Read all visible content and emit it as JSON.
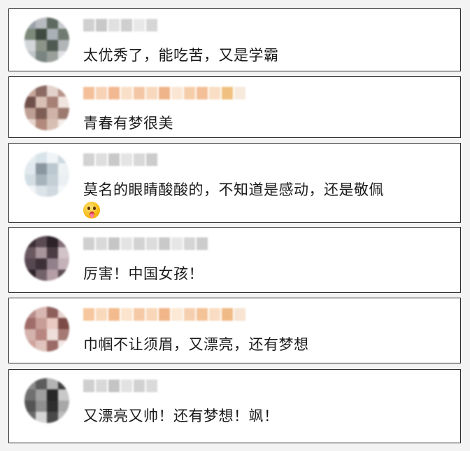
{
  "comments": [
    {
      "text": "太优秀了，能吃苦，又是学霸",
      "avatar_colors": [
        "#9aa0a8",
        "#b8bcc0",
        "#5e6a60",
        "#c6c9cd",
        "#7d8a7a",
        "#3f4a40",
        "#a9b0b6",
        "#6f7a70",
        "#d3d6d9",
        "#8c948a",
        "#4e5a52",
        "#b1b5b8",
        "#c0c4c8",
        "#7a8480",
        "#99a09c",
        "#e0e2e4"
      ],
      "name_colors": [
        "#d0d0d0",
        "#c8c8c8",
        "#e0e0e0",
        "#cfcfcf",
        "#e8e8e8",
        "#d6d6d6"
      ]
    },
    {
      "text": "青春有梦很美",
      "avatar_colors": [
        "#c7a79b",
        "#8a6a62",
        "#e3d2cb",
        "#b69387",
        "#6f4f4a",
        "#d9c0b5",
        "#a68074",
        "#f0e4de",
        "#bf9f93",
        "#7e5d55",
        "#cfb3a8",
        "#9c7a70",
        "#e6d4cc",
        "#b2897c",
        "#d8bfb4",
        "#f3ebe6"
      ],
      "name_colors": [
        "#f4c09a",
        "#f7d2b5",
        "#f2b891",
        "#f9dfc8",
        "#f4c6a4",
        "#f8d8bd",
        "#f0b48a",
        "#fbe6d3",
        "#f5cda9",
        "#f3bf97",
        "#f9ddc4",
        "#f0c080",
        "#f7e9dc"
      ]
    },
    {
      "text": "莫名的眼睛酸酸的，不知道是感动，还是敬佩",
      "emoji": true,
      "avatar_colors": [
        "#e7eef2",
        "#d9e4ea",
        "#f0f4f6",
        "#cdd9e0",
        "#e1e9ee",
        "#8a96a0",
        "#bcc8d0",
        "#eef2f4",
        "#d3dee4",
        "#a7b3bb",
        "#c3ced5",
        "#e9eff2",
        "#f2f5f7",
        "#dbe4e9",
        "#cfd9df",
        "#f5f8f9"
      ],
      "name_colors": [
        "#d2d2d2",
        "#dedede",
        "#c9c9c9",
        "#e4e4e4",
        "#d8d8d8",
        "#cccccc"
      ]
    },
    {
      "text": "厉害！中国女孩！",
      "avatar_colors": [
        "#3a2e34",
        "#5b4a52",
        "#2c2228",
        "#806c74",
        "#6a5860",
        "#a8949b",
        "#4b3c43",
        "#d2c3c8",
        "#574750",
        "#3d3037",
        "#92808a",
        "#c4b2b8",
        "#2f242a",
        "#73626a",
        "#b59ea6",
        "#5d4c54"
      ],
      "name_colors": [
        "#cfcfcf",
        "#d9d9d9",
        "#c6c6c6",
        "#e3e3e3",
        "#d2d2d2",
        "#dcdcdc",
        "#c9c9c9",
        "#e6e6e6",
        "#d5d5d5",
        "#cccccc"
      ]
    },
    {
      "text": "巾帼不让须眉，又漂亮，还有梦想",
      "avatar_colors": [
        "#b98c8c",
        "#d8b7b2",
        "#8f5f5c",
        "#e6d2cd",
        "#a06c68",
        "#c79d98",
        "#e9c9c2",
        "#7c4b47",
        "#d4b3ad",
        "#b88580",
        "#efdfdb",
        "#a67a74",
        "#cfa39d",
        "#e0c3bd",
        "#9c6a66",
        "#f3e6e3"
      ],
      "name_colors": [
        "#f6c79e",
        "#f9d9bb",
        "#f3bb8d",
        "#fbe3cc",
        "#f5c9a4",
        "#f8d6b7",
        "#f1b588",
        "#fbe8d5",
        "#f6cfae",
        "#f4c297",
        "#f9dcc3",
        "#f0ba86",
        "#f7e4d2"
      ]
    },
    {
      "text": "又漂亮又帅！还有梦想！飒！",
      "avatar_colors": [
        "#8a8a8a",
        "#5c5c5c",
        "#b3b3b3",
        "#3f3f3f",
        "#707070",
        "#9f9f9f",
        "#262626",
        "#c9c9c9",
        "#545454",
        "#8f8f8f",
        "#2e2e2e",
        "#a8a8a8",
        "#6a6a6a",
        "#d6d6d6",
        "#494949",
        "#bdbdbd"
      ],
      "name_colors": [
        "#cfcfcf",
        "#d9d9d9",
        "#c4c4c4",
        "#e2e2e2",
        "#d1d1d1",
        "#dadada"
      ]
    }
  ]
}
